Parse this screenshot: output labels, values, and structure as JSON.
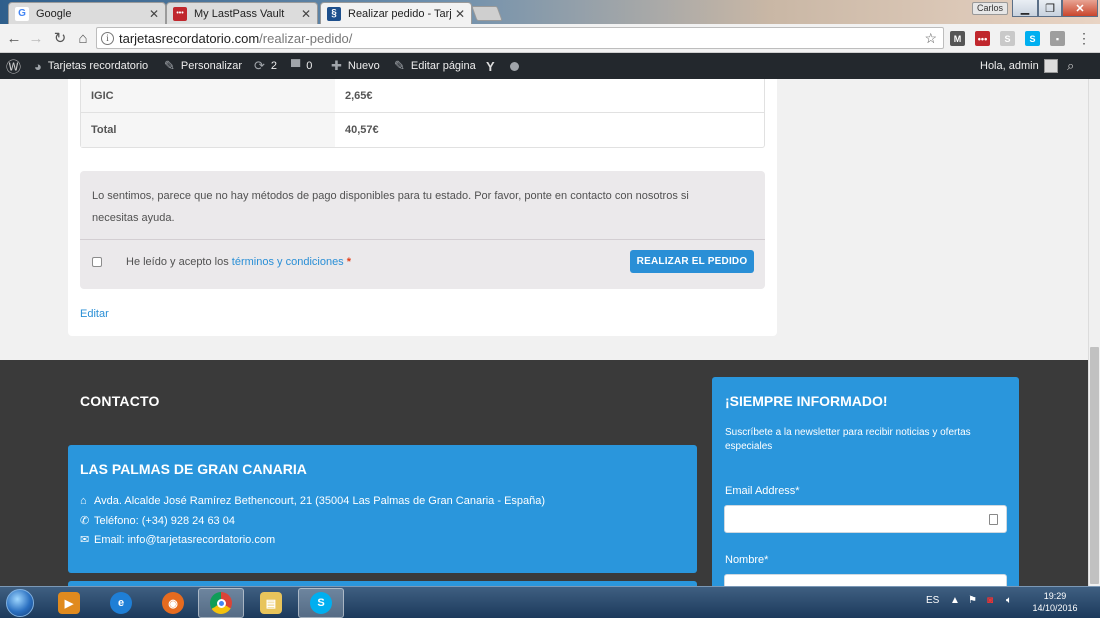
{
  "browser": {
    "tabs": [
      {
        "title": "Google",
        "favicon": "G"
      },
      {
        "title": "My LastPass Vault",
        "favicon": "•••"
      },
      {
        "title": "Realizar pedido - Tarjetas",
        "favicon": "§"
      }
    ],
    "user_badge": "Carlos",
    "url_host": "tarjetasrecordatorio.com",
    "url_path": "/realizar-pedido/"
  },
  "adminbar": {
    "site_name": "Tarjetas recordatorio",
    "customize": "Personalizar",
    "updates_count": "2",
    "comments_count": "0",
    "new_label": "Nuevo",
    "edit_page": "Editar página",
    "greeting": "Hola, admin"
  },
  "order": {
    "totals": [
      {
        "label": "IGIC",
        "value": "2,65€"
      },
      {
        "label": "Total",
        "value": "40,57€"
      }
    ],
    "payment_notice": "Lo sentimos, parece que no hay métodos de pago disponibles para tu estado. Por favor, ponte en contacto con nosotros si necesitas ayuda.",
    "terms_prefix": "He leído y acepto los",
    "terms_link": "términos y condiciones",
    "terms_required": "*",
    "place_order": "REALIZAR EL PEDIDO",
    "edit_link": "Editar"
  },
  "footer": {
    "contact_title": "CONTACTO",
    "office": {
      "title": "LAS PALMAS DE GRAN CANARIA",
      "address": "Avda. Alcalde José Ramírez Bethencourt, 21 (35004 Las Palmas de Gran Canaria - España)",
      "phone": "Teléfono: (+34) 928 24 63 04",
      "email": "Email: info@tarjetasrecordatorio.com"
    },
    "newsletter": {
      "title": "¡SIEMPRE INFORMADO!",
      "description": "Suscríbete a la newsletter para recibir noticias y ofertas especiales",
      "email_label": "Email Address*",
      "name_label": "Nombre*"
    }
  },
  "taskbar": {
    "language": "ES",
    "time": "19:29",
    "date": "14/10/2016"
  },
  "colors": {
    "accent": "#2a96dc",
    "button": "#2a8fd6",
    "footer_bg": "#3a3a3a",
    "adminbar_bg": "#23282d"
  }
}
